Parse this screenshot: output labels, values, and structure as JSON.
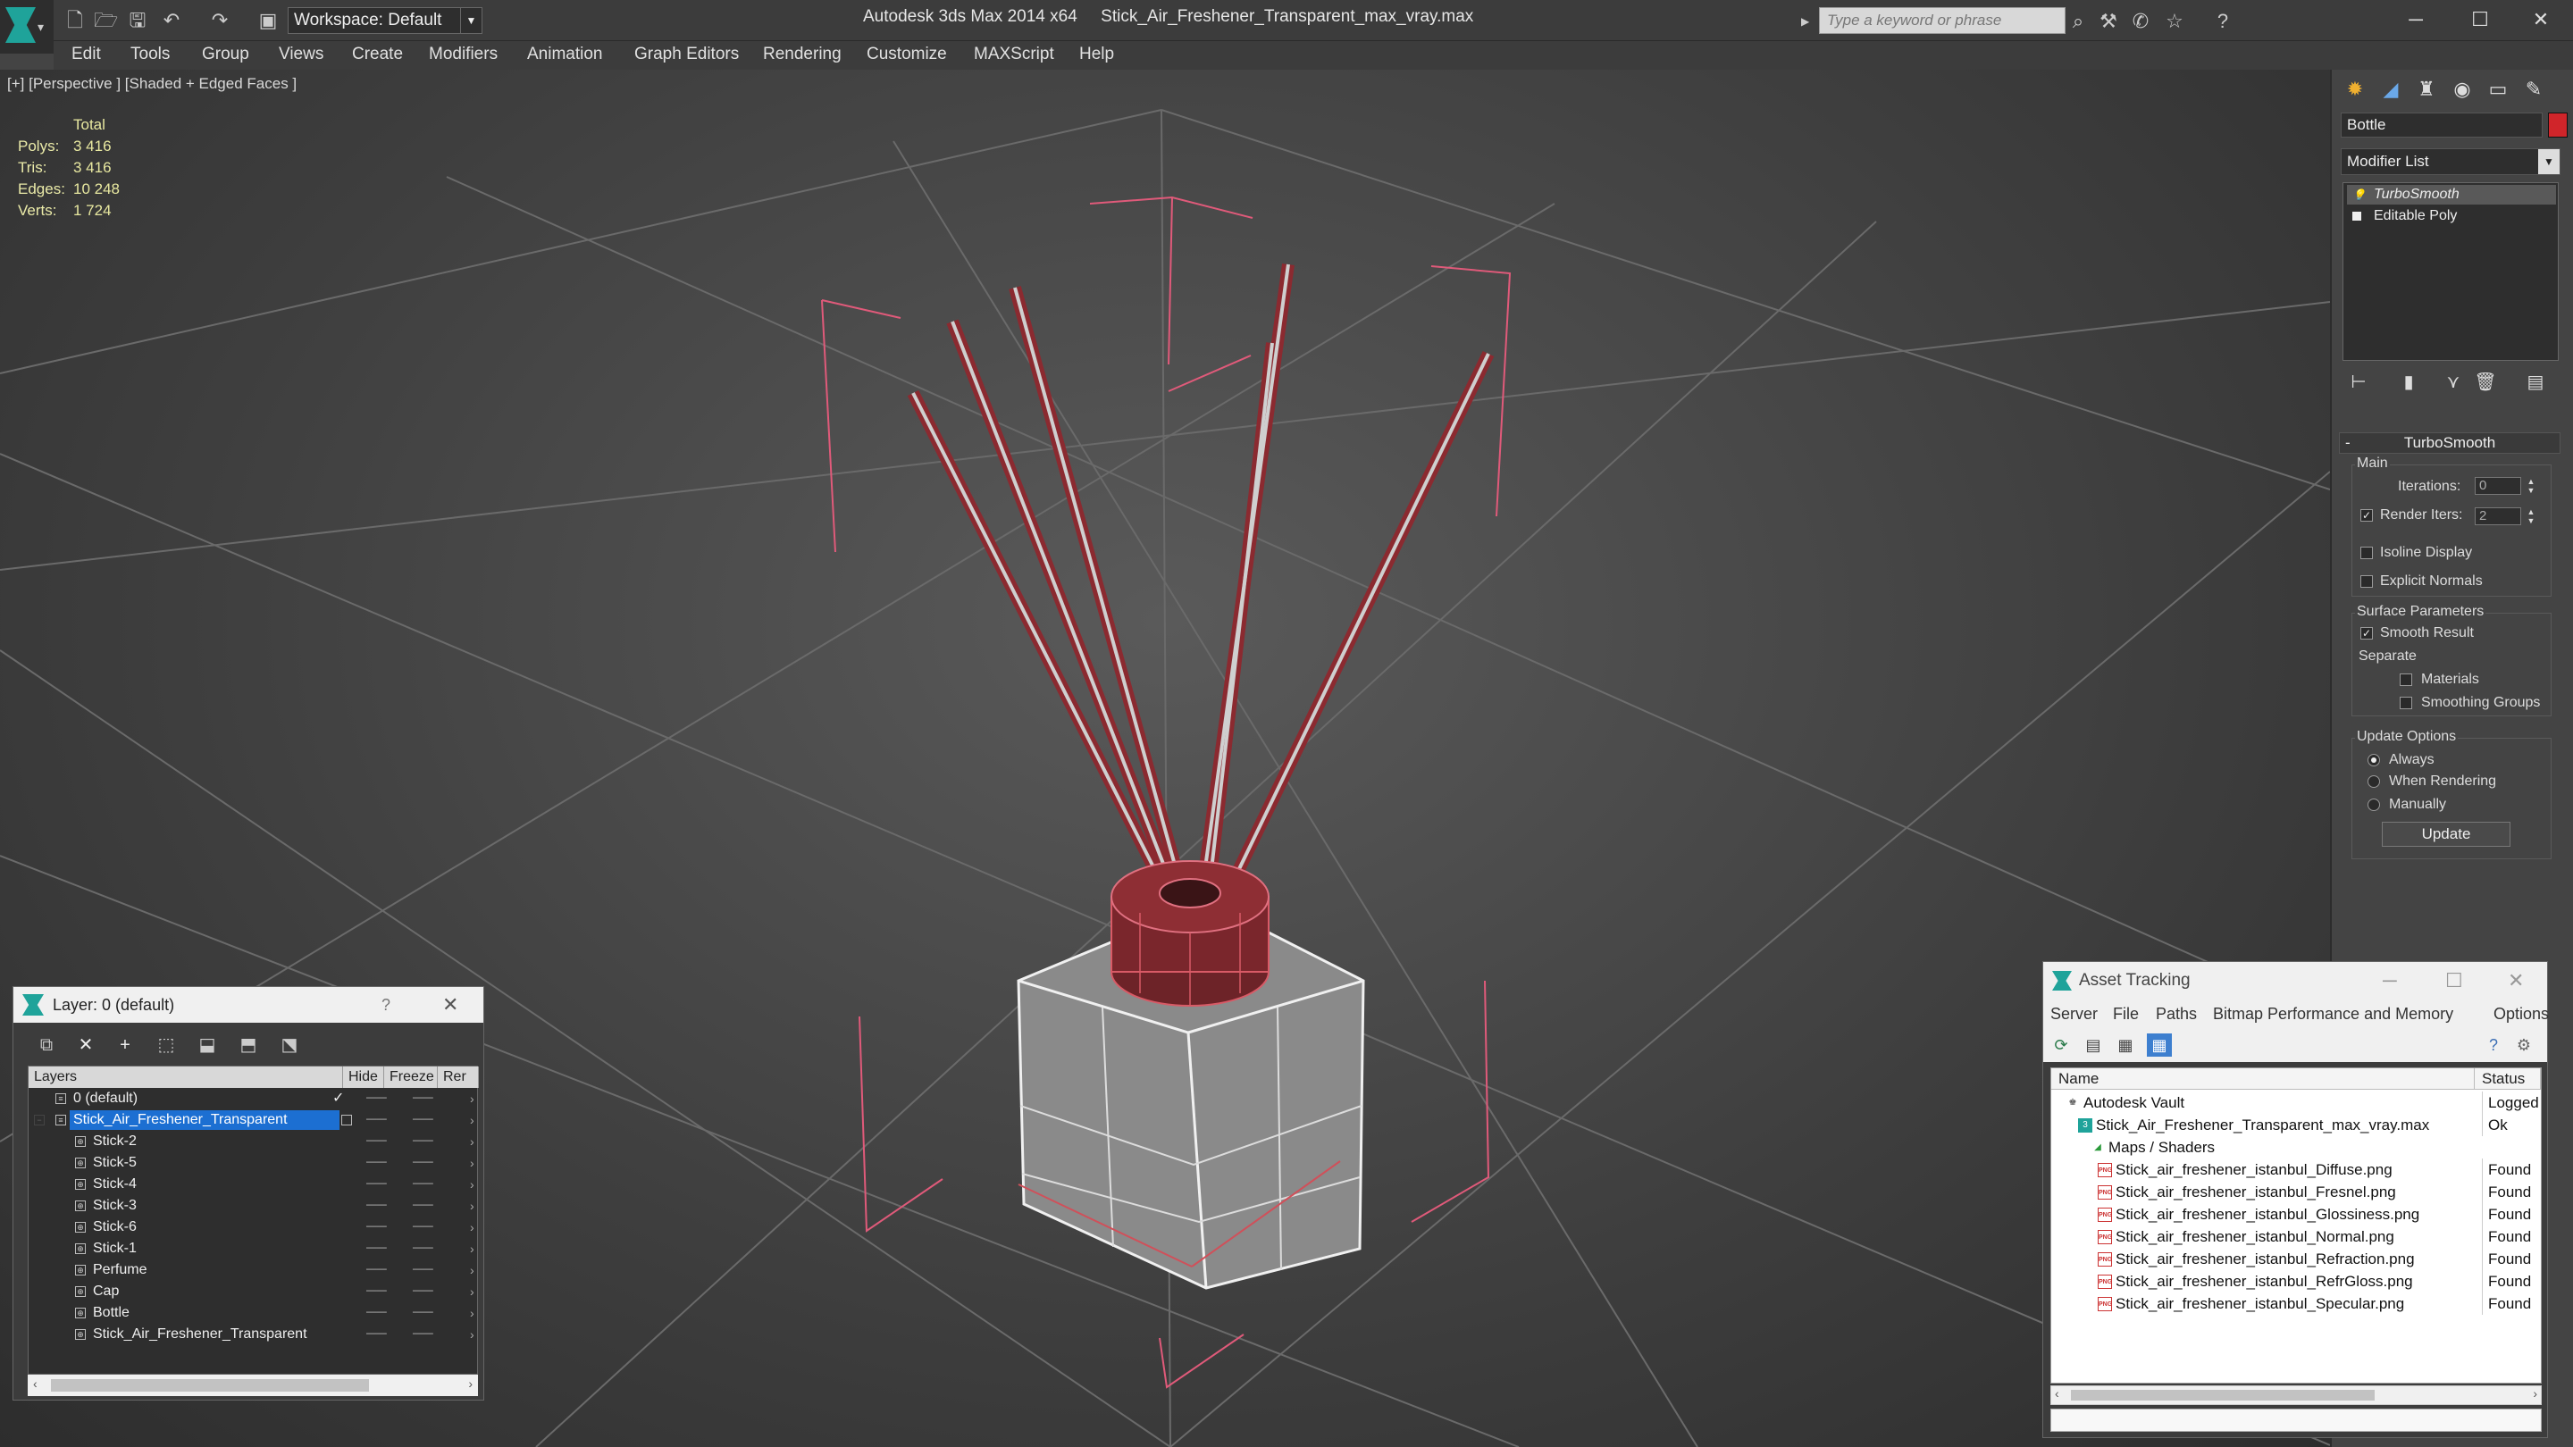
{
  "window": {
    "app_title": "Autodesk 3ds Max 2014 x64",
    "file_title": "Stick_Air_Freshener_Transparent_max_vray.max",
    "workspace_label": "Workspace: Default",
    "search_placeholder": "Type a keyword or phrase"
  },
  "menu": [
    "Edit",
    "Tools",
    "Group",
    "Views",
    "Create",
    "Modifiers",
    "Animation",
    "Graph Editors",
    "Rendering",
    "Customize",
    "MAXScript",
    "Help"
  ],
  "viewport": {
    "label": "[+] [Perspective ] [Shaded + Edged Faces ]",
    "stats_header": "Total",
    "stats": [
      {
        "key": "Polys:",
        "value": "3 416"
      },
      {
        "key": "Tris:",
        "value": "3 416"
      },
      {
        "key": "Edges:",
        "value": "10 248"
      },
      {
        "key": "Verts:",
        "value": "1 724"
      }
    ]
  },
  "command_panel": {
    "object_name": "Bottle",
    "object_color": "#d0252a",
    "modifier_list": "Modifier List",
    "stack": [
      "TurboSmooth",
      "Editable Poly"
    ],
    "rollout_title": "TurboSmooth",
    "main_group": "Main",
    "iterations_label": "Iterations:",
    "iterations_value": "0",
    "render_iters_label": "Render Iters:",
    "render_iters_value": "2",
    "isoline_label": "Isoline Display",
    "explicit_normals_label": "Explicit Normals",
    "surface_group": "Surface Parameters",
    "smooth_result_label": "Smooth Result",
    "separate_label": "Separate",
    "materials_label": "Materials",
    "smoothing_groups_label": "Smoothing Groups",
    "update_group": "Update Options",
    "always_label": "Always",
    "when_rendering_label": "When Rendering",
    "manually_label": "Manually",
    "update_button": "Update"
  },
  "layer_dialog": {
    "title": "Layer: 0 (default)",
    "help": "?",
    "columns": [
      "Layers",
      "Hide",
      "Freeze",
      "Rer"
    ],
    "rows": [
      {
        "name": "0 (default)",
        "level": 0
      },
      {
        "name": "Stick_Air_Freshener_Transparent",
        "level": 0,
        "selected": true
      },
      {
        "name": "Stick-2",
        "level": 1
      },
      {
        "name": "Stick-5",
        "level": 1
      },
      {
        "name": "Stick-4",
        "level": 1
      },
      {
        "name": "Stick-3",
        "level": 1
      },
      {
        "name": "Stick-6",
        "level": 1
      },
      {
        "name": "Stick-1",
        "level": 1
      },
      {
        "name": "Perfume",
        "level": 1
      },
      {
        "name": "Cap",
        "level": 1
      },
      {
        "name": "Bottle",
        "level": 1
      },
      {
        "name": "Stick_Air_Freshener_Transparent",
        "level": 1
      }
    ]
  },
  "asset_tracking": {
    "title": "Asset Tracking",
    "menu": [
      "Server",
      "File",
      "Paths",
      "Bitmap Performance and Memory",
      "Options"
    ],
    "columns": [
      "Name",
      "Status"
    ],
    "rows": [
      {
        "name": "Autodesk Vault",
        "status": "Logged Out",
        "indent": 1,
        "icon": "vault"
      },
      {
        "name": "Stick_Air_Freshener_Transparent_max_vray.max",
        "status": "Ok",
        "indent": 2,
        "icon": "max"
      },
      {
        "name": "Maps / Shaders",
        "status": "",
        "indent": 3,
        "icon": "maps"
      },
      {
        "name": "Stick_air_freshener_istanbul_Diffuse.png",
        "status": "Found",
        "indent": 4,
        "icon": "png"
      },
      {
        "name": "Stick_air_freshener_istanbul_Fresnel.png",
        "status": "Found",
        "indent": 4,
        "icon": "png"
      },
      {
        "name": "Stick_air_freshener_istanbul_Glossiness.png",
        "status": "Found",
        "indent": 4,
        "icon": "png"
      },
      {
        "name": "Stick_air_freshener_istanbul_Normal.png",
        "status": "Found",
        "indent": 4,
        "icon": "png"
      },
      {
        "name": "Stick_air_freshener_istanbul_Refraction.png",
        "status": "Found",
        "indent": 4,
        "icon": "png"
      },
      {
        "name": "Stick_air_freshener_istanbul_RefrGloss.png",
        "status": "Found",
        "indent": 4,
        "icon": "png"
      },
      {
        "name": "Stick_air_freshener_istanbul_Specular.png",
        "status": "Found",
        "indent": 4,
        "icon": "png"
      }
    ]
  }
}
